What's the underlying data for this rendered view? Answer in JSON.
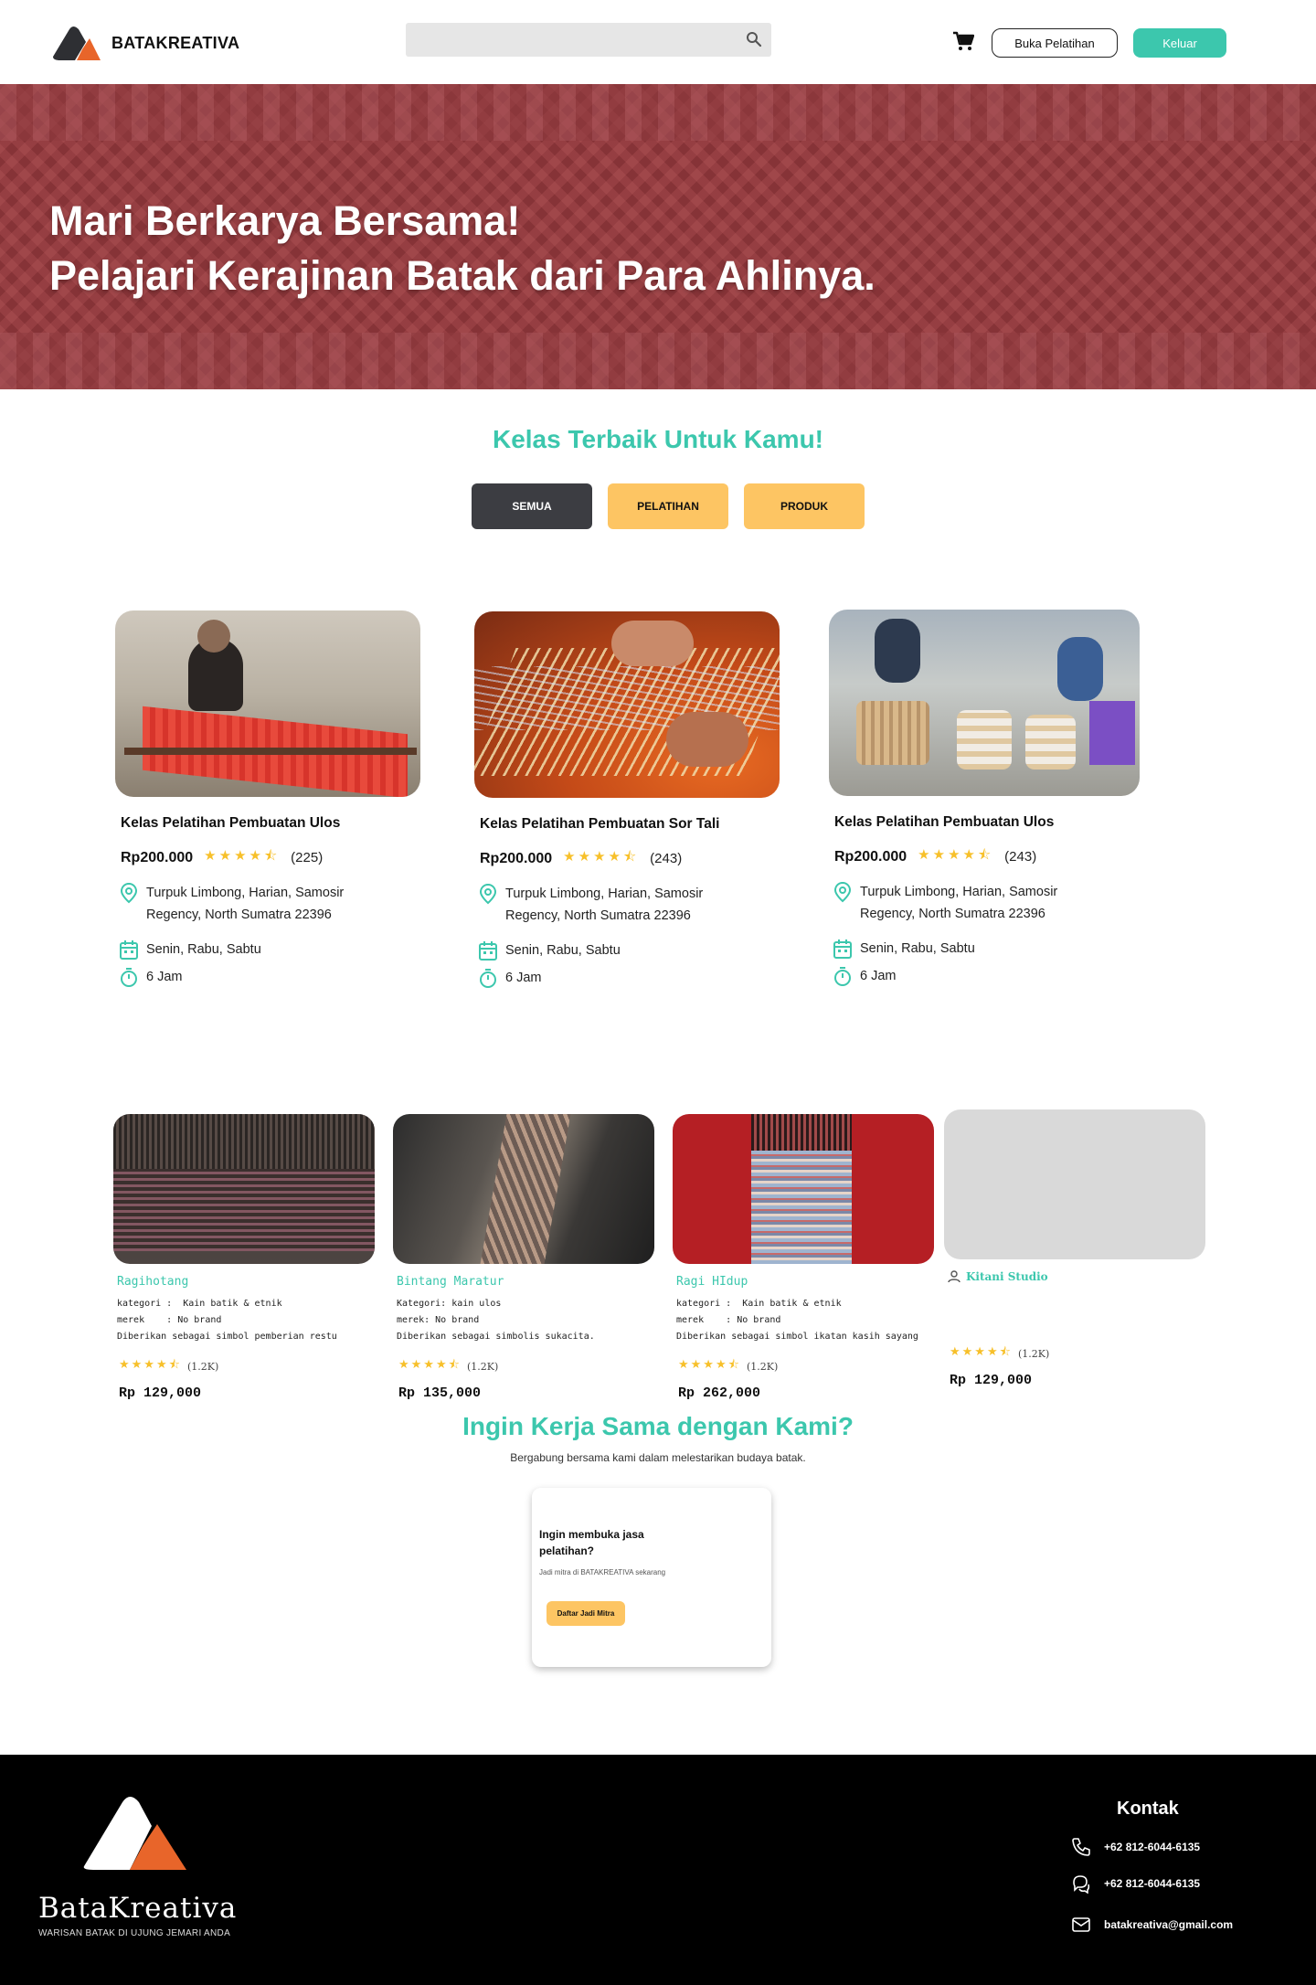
{
  "header": {
    "brand": "BATAKREATIVA",
    "search_placeholder": "",
    "open_training_label": "Buka Pelatihan",
    "logout_label": "Keluar"
  },
  "hero": {
    "line1": "Mari Berkarya Bersama!",
    "line2": "Pelajari Kerajinan Batak dari Para Ahlinya."
  },
  "classes": {
    "title": "Kelas Terbaik Untuk Kamu!",
    "filters": [
      "SEMUA",
      "PELATIHAN",
      "PRODUK"
    ],
    "active_filter": "SEMUA",
    "cards": [
      {
        "title": "Kelas Pelatihan Pembuatan Ulos",
        "price": "Rp200.000",
        "rating": 4.5,
        "count": "(225)",
        "address1": "Turpuk Limbong, Harian, Samosir",
        "address2": "Regency, North Sumatra 22396",
        "days": "Senin, Rabu, Sabtu",
        "duration": "6 Jam"
      },
      {
        "title": "Kelas Pelatihan Pembuatan Sor Tali",
        "price": "Rp200.000",
        "rating": 4.5,
        "count": "(243)",
        "address1": "Turpuk Limbong, Harian, Samosir",
        "address2": "Regency, North Sumatra 22396",
        "days": "Senin, Rabu, Sabtu",
        "duration": "6 Jam"
      },
      {
        "title": "Kelas Pelatihan Pembuatan Ulos",
        "price": "Rp200.000",
        "rating": 4.5,
        "count": "(243)",
        "address1": "Turpuk Limbong, Harian, Samosir",
        "address2": "Regency, North Sumatra 22396",
        "days": "Senin, Rabu, Sabtu",
        "duration": "6 Jam"
      }
    ]
  },
  "products": [
    {
      "name": "Ragihotang",
      "meta": "kategori :  Kain batik & etnik\nmerek    : No brand\nDiberikan sebagai simbol pemberian restu",
      "rating": 4.5,
      "count": "(1.2K)",
      "price": "Rp 129,000"
    },
    {
      "name": "Bintang Maratur",
      "meta": "Kategori: kain ulos\nmerek: No brand\nDiberikan sebagai simbolis sukacita.",
      "rating": 4.5,
      "count": "(1.2K)",
      "price": "Rp 135,000"
    },
    {
      "name": "Ragi HIdup",
      "meta": "kategori :  Kain batik & etnik\nmerek    : No brand\nDiberikan sebagai simbol ikatan kasih sayang",
      "rating": 4.5,
      "count": "(1.2K)",
      "price": "Rp 262,000"
    },
    {
      "studio": "Kitani Studio",
      "rating": 4.5,
      "count": "(1.2K)",
      "price": "Rp 129,000"
    }
  ],
  "partner": {
    "title": "Ingin Kerja Sama dengan Kami?",
    "subtitle": "Bergabung bersama kami dalam  melestarikan budaya batak.",
    "card_title": "Ingin membuka jasa pelatihan?",
    "card_text": "Jadi mitra di BATAKREATIVA sekarang",
    "card_button": "Daftar Jadi Mitra"
  },
  "footer": {
    "brand": "BataKreativa",
    "tagline": "WARISAN BATAK DI UJUNG JEMARI ANDA",
    "contact_title": "Kontak",
    "phone": "+62 812-6044-6135",
    "whatsapp": "+62 812-6044-6135",
    "email": "batakreativa@gmail.com"
  },
  "colors": {
    "teal": "#3cc7ad",
    "yellow": "#fdc563",
    "dark": "#3c3d42",
    "hero": "#8e3a3d",
    "star": "#f7c02a",
    "orange": "#e8652a"
  },
  "icons": [
    "search-icon",
    "cart-icon",
    "location-pin-icon",
    "calendar-icon",
    "stopwatch-icon",
    "star-icon",
    "user-icon",
    "phone-icon",
    "chat-icon",
    "mail-icon"
  ]
}
